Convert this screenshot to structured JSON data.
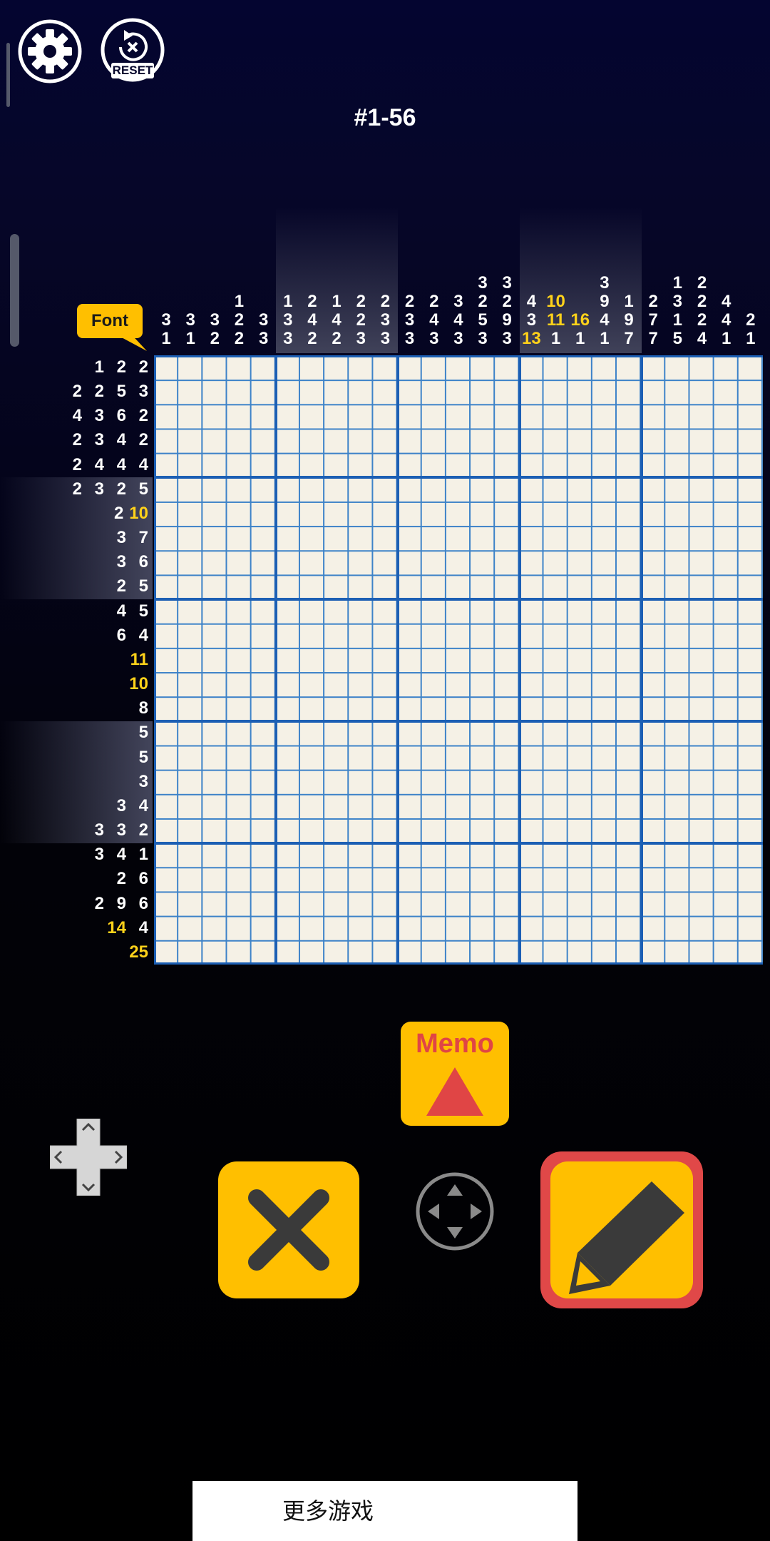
{
  "puzzle": {
    "title": "#1-56",
    "size": 25
  },
  "toolbar": {
    "settings_icon": "gear-icon",
    "reset_icon": "reset-icon",
    "reset_label": "RESET"
  },
  "font_button": {
    "label": "Font"
  },
  "column_clues": [
    {
      "nums": [
        "3",
        "1"
      ]
    },
    {
      "nums": [
        "3",
        "1"
      ]
    },
    {
      "nums": [
        "3",
        "2"
      ]
    },
    {
      "nums": [
        "1",
        "2",
        "2"
      ]
    },
    {
      "nums": [
        "3",
        "3"
      ]
    },
    {
      "nums": [
        "1",
        "3",
        "3"
      ]
    },
    {
      "nums": [
        "2",
        "4",
        "2"
      ]
    },
    {
      "nums": [
        "1",
        "4",
        "2"
      ]
    },
    {
      "nums": [
        "2",
        "2",
        "3"
      ]
    },
    {
      "nums": [
        "2",
        "3",
        "3"
      ]
    },
    {
      "nums": [
        "2",
        "3",
        "3"
      ]
    },
    {
      "nums": [
        "2",
        "4",
        "3"
      ]
    },
    {
      "nums": [
        "3",
        "4",
        "3"
      ]
    },
    {
      "nums": [
        "3",
        "2",
        "5",
        "3"
      ]
    },
    {
      "nums": [
        "3",
        "2",
        "9",
        "3"
      ]
    },
    {
      "nums": [
        "4",
        "3",
        "13"
      ],
      "yellow": [
        2
      ]
    },
    {
      "nums": [
        "10",
        "11",
        "1"
      ],
      "yellow": [
        0,
        1
      ]
    },
    {
      "nums": [
        "16",
        "1"
      ],
      "yellow": [
        0
      ]
    },
    {
      "nums": [
        "3",
        "9",
        "4",
        "1"
      ]
    },
    {
      "nums": [
        "1",
        "9",
        "7"
      ]
    },
    {
      "nums": [
        "2",
        "7",
        "7"
      ]
    },
    {
      "nums": [
        "1",
        "3",
        "1",
        "5"
      ]
    },
    {
      "nums": [
        "2",
        "2",
        "2",
        "4"
      ]
    },
    {
      "nums": [
        "4",
        "4",
        "1"
      ]
    },
    {
      "nums": [
        "2",
        "1"
      ]
    }
  ],
  "row_clues": [
    {
      "nums": [
        "1",
        "2",
        "2"
      ]
    },
    {
      "nums": [
        "2",
        "2",
        "5",
        "3"
      ]
    },
    {
      "nums": [
        "4",
        "3",
        "6",
        "2"
      ]
    },
    {
      "nums": [
        "2",
        "3",
        "4",
        "2"
      ]
    },
    {
      "nums": [
        "2",
        "4",
        "4",
        "4"
      ]
    },
    {
      "nums": [
        "2",
        "3",
        "2",
        "5"
      ]
    },
    {
      "nums": [
        "2",
        "10"
      ],
      "yellow": [
        1
      ]
    },
    {
      "nums": [
        "3",
        "7"
      ]
    },
    {
      "nums": [
        "3",
        "6"
      ]
    },
    {
      "nums": [
        "2",
        "5"
      ]
    },
    {
      "nums": [
        "4",
        "5"
      ]
    },
    {
      "nums": [
        "6",
        "4"
      ]
    },
    {
      "nums": [
        "11"
      ],
      "yellow": [
        0
      ]
    },
    {
      "nums": [
        "10"
      ],
      "yellow": [
        0
      ]
    },
    {
      "nums": [
        "8"
      ]
    },
    {
      "nums": [
        "5"
      ]
    },
    {
      "nums": [
        "5"
      ]
    },
    {
      "nums": [
        "3"
      ]
    },
    {
      "nums": [
        "3",
        "4"
      ]
    },
    {
      "nums": [
        "3",
        "3",
        "2"
      ]
    },
    {
      "nums": [
        "3",
        "4",
        "1"
      ]
    },
    {
      "nums": [
        "2",
        "6"
      ]
    },
    {
      "nums": [
        "2",
        "9",
        "6"
      ]
    },
    {
      "nums": [
        "14",
        "4"
      ],
      "yellow": [
        0
      ]
    },
    {
      "nums": [
        "25"
      ],
      "yellow": [
        0
      ]
    }
  ],
  "highlighted_column_groups": [
    2,
    4
  ],
  "highlighted_row_groups": [
    2,
    4
  ],
  "controls": {
    "memo_label": "Memo",
    "memo_icon": "triangle-icon",
    "dpad_icon": "dpad-icon",
    "cross_icon": "cross-icon",
    "move_icon": "move-arrows-icon",
    "pencil_icon": "pencil-icon",
    "active_tool": "pencil"
  },
  "footer": {
    "more_games_label": "更多游戏"
  },
  "colors": {
    "accent": "#ffbf00",
    "clue_highlight": "#ffd21a",
    "active_frame": "#e04848",
    "grid_major": "#1c5fb4",
    "grid_minor": "#3c82c8",
    "cell": "#f5f1e6"
  }
}
